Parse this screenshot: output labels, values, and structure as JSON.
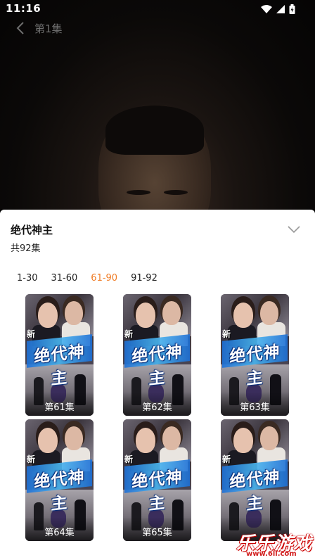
{
  "status_bar": {
    "time": "11:16"
  },
  "player": {
    "episode_title": "第1集"
  },
  "sheet": {
    "title": "绝代神主",
    "count": "共92集",
    "tabs": [
      {
        "label": "1-30",
        "active": false
      },
      {
        "label": "31-60",
        "active": false
      },
      {
        "label": "61-90",
        "active": true
      },
      {
        "label": "91-92",
        "active": false
      }
    ],
    "accent_color": "#f07b24",
    "episodes": [
      {
        "label": "第61集",
        "thumb_title": "绝代神主",
        "thumb_tag": "新"
      },
      {
        "label": "第62集",
        "thumb_title": "绝代神主",
        "thumb_tag": "新"
      },
      {
        "label": "第63集",
        "thumb_title": "绝代神主",
        "thumb_tag": "新"
      },
      {
        "label": "第64集",
        "thumb_title": "绝代神主",
        "thumb_tag": "新"
      },
      {
        "label": "第65集",
        "thumb_title": "绝代神主",
        "thumb_tag": "新"
      },
      {
        "label": "",
        "thumb_title": "绝代神主",
        "thumb_tag": "新"
      }
    ]
  },
  "watermark": {
    "text": "乐乐游戏",
    "url": "www.6ll.com"
  },
  "icons": {
    "back": "chevron-left-icon",
    "collapse": "chevron-down-icon",
    "wifi": "wifi-icon",
    "signal": "signal-icon",
    "battery": "battery-icon"
  }
}
